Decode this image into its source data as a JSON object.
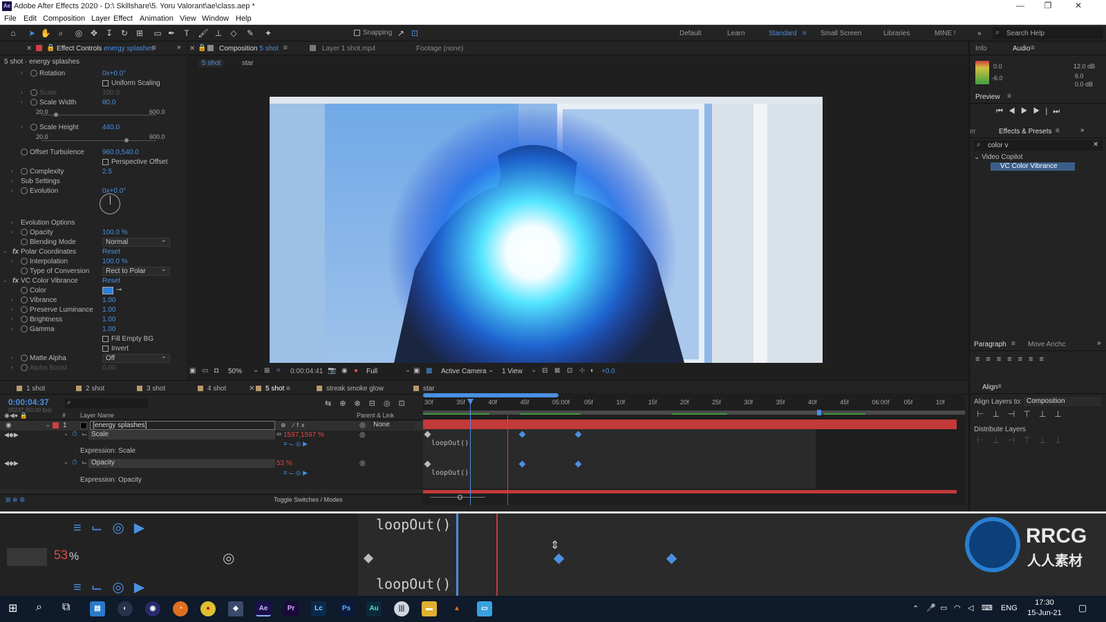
{
  "app": {
    "title": "Adobe After Effects 2020 - D:\\ Skillshare\\5. Yoru Valorant\\ae\\class.aep *",
    "icon": "Ae"
  },
  "menu": [
    "File",
    "Edit",
    "Composition",
    "Layer",
    "Effect",
    "Animation",
    "View",
    "Window",
    "Help"
  ],
  "toolbar": {
    "snapping": "Snapping",
    "workspaces": [
      "Default",
      "Learn",
      "Standard",
      "Small Screen",
      "Libraries",
      "MINE !"
    ],
    "active_workspace": "Standard",
    "search_help": "Search Help"
  },
  "effect_controls": {
    "tab_label": "Effect Controls",
    "layer_name": "energy splashes",
    "breadcrumb": "5 shot · energy splashes",
    "rows": [
      {
        "label": "Rotation",
        "value": "0x+0.0°"
      },
      {
        "label": "Uniform Scaling",
        "check": "Uniform Scaling"
      },
      {
        "label": "Scale",
        "value": "100.0"
      },
      {
        "label": "Scale Width",
        "value": "80.0",
        "min": "20.0",
        "max": "600.0"
      },
      {
        "label": "Scale Height",
        "value": "440.0",
        "min": "20.0",
        "max": "600.0"
      },
      {
        "label": "Offset Turbulence",
        "value": "960.0,540.0"
      },
      {
        "label": "Perspective Offset",
        "check": "Perspective Offset"
      },
      {
        "label": "Complexity",
        "value": "2.5"
      },
      {
        "label": "Sub Settings"
      },
      {
        "label": "Evolution",
        "value": "0x+0.0°"
      },
      {
        "label": "Evolution Options"
      },
      {
        "label": "Opacity",
        "value": "100.0 %"
      },
      {
        "label": "Blending Mode",
        "value": "Normal"
      },
      {
        "label": "Polar Coordinates",
        "value": "Reset"
      },
      {
        "label": "Interpolation",
        "value": "100.0 %"
      },
      {
        "label": "Type of Conversion",
        "value": "Rect to Polar"
      },
      {
        "label": "VC Color Vibrance",
        "value": "Reset"
      },
      {
        "label": "Color"
      },
      {
        "label": "Vibrance",
        "value": "1.00"
      },
      {
        "label": "Preserve Luminance",
        "value": "1.00"
      },
      {
        "label": "Brightness",
        "value": "1.00"
      },
      {
        "label": "Gamma",
        "value": "1.00"
      },
      {
        "label": "Fill Empty BG",
        "check": "Fill Empty BG"
      },
      {
        "label": "Invert",
        "check": "Invert"
      },
      {
        "label": "Matte Alpha",
        "value": "Off"
      },
      {
        "label": "Alpha Boost",
        "value": "0.00"
      }
    ]
  },
  "composition": {
    "tab_label": "Composition",
    "comp_name": "5 shot",
    "layer_tab": "Layer 1 shot.mp4",
    "footage_tab": "Footage (none)",
    "breadcrumbs": [
      "5 shot",
      "star"
    ],
    "zoom": "50%",
    "timecode": "0:00:04:41",
    "resolution": "Full",
    "camera": "Active Camera",
    "views": "1 View",
    "exposure": "+0.0"
  },
  "right_panels": {
    "info": "Info",
    "audio": "Audio",
    "audio_levels": [
      "0.0",
      "-6.0",
      "12.0 dB",
      "6.0",
      "0.0 dB"
    ],
    "preview": "Preview",
    "effects_presets": "Effects & Presets",
    "search_value": "color v",
    "tree_group": "Video Copilot",
    "tree_item": "VC Color Vibrance",
    "paragraph": "Paragraph",
    "move_anchor": "Move Anchc",
    "align": "Align",
    "align_layers_to": "Align Layers to:",
    "align_target": "Composition",
    "distribute": "Distribute Layers"
  },
  "timeline": {
    "tabs": [
      "1 shot",
      "2 shot",
      "3 shot",
      "4 shot",
      "5 shot",
      "streak smoke glow",
      "star"
    ],
    "tab_colors": [
      "#b89a6a",
      "#b89a6a",
      "#b89a6a",
      "#b89a6a",
      "#b89a6a",
      "#b89a6a",
      "#b89a6a"
    ],
    "active_tab": "5 shot",
    "current_time": "0:00:04:37",
    "frame_info": "00237 (50.00 fps)",
    "columns": {
      "layer_name": "Layer Name",
      "parent": "Parent & Link"
    },
    "ruler": [
      "30f",
      "35f",
      "40f",
      "45f",
      "05:00f",
      "05f",
      "10f",
      "15f",
      "20f",
      "25f",
      "30f",
      "35f",
      "40f",
      "45f",
      "06:00f",
      "05f",
      "10f"
    ],
    "layer": {
      "num": "1",
      "name": "[energy splashes]",
      "parent": "None"
    },
    "scale_label": "Scale",
    "scale_value": "1597,1597 %",
    "expr_scale": "Expression: Scale",
    "opacity_label": "Opacity",
    "opacity_value": "53 %",
    "expr_opacity": "Expression: Opacity",
    "expression_code": "loopOut()",
    "toggle": "Toggle Switches / Modes"
  },
  "zoom_overlay": {
    "code": "loopOut()",
    "value": "53",
    "unit": "%"
  },
  "taskbar": {
    "apps": [
      "Ae",
      "Pr",
      "Lc",
      "Ps",
      "Au"
    ],
    "lang": "ENG",
    "time": "17:30",
    "date": "15-Jun-21"
  },
  "watermark": {
    "logo_text": "RRCG",
    "sub": "人人素材"
  },
  "colors": {
    "accent": "#4a90e2",
    "label_red": "#e04848",
    "playhead": "#4a90e2",
    "work_area": "#c23a3a"
  }
}
